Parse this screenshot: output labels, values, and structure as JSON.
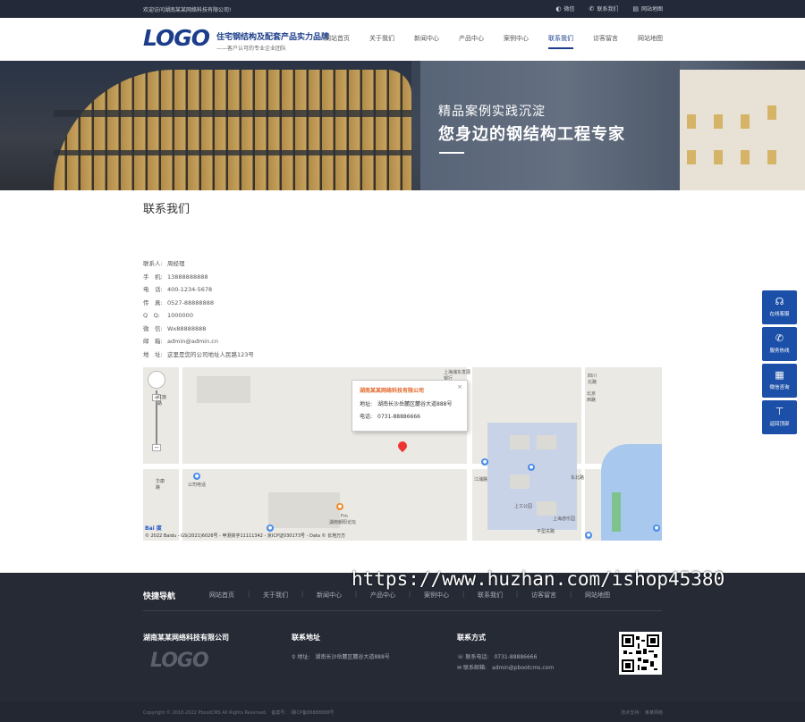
{
  "topbar": {
    "welcome": "欢迎访问湖南某某网络科技有限公司!",
    "links": [
      {
        "icon": "wechat-icon",
        "label": "微信"
      },
      {
        "icon": "phone-icon",
        "label": "联系我们"
      },
      {
        "icon": "sitemap-icon",
        "label": "网站地图"
      }
    ]
  },
  "header": {
    "logo": "LOGO",
    "slogan_main": "住宅钢结构及配套产品实力品牌",
    "slogan_sub": "——客户认可的专业企业团队",
    "nav": [
      "网站首页",
      "关于我们",
      "新闻中心",
      "产品中心",
      "案例中心",
      "联系我们",
      "访客留言",
      "网站地图"
    ],
    "active_nav": "联系我们"
  },
  "banner": {
    "line1": "精品案例实践沉淀",
    "line2": "您身边的钢结构工程专家"
  },
  "page": {
    "title": "联系我们"
  },
  "contact": [
    {
      "label": "联系人:",
      "value": "周经理"
    },
    {
      "label": "手　机:",
      "value": "13888888888"
    },
    {
      "label": "电　话:",
      "value": "400-1234-5678"
    },
    {
      "label": "传　真:",
      "value": "0527-88888888"
    },
    {
      "label": "Q　Q:",
      "value": "1000000"
    },
    {
      "label": "微　信:",
      "value": "Wx88888888"
    },
    {
      "label": "邮　箱:",
      "value": "admin@admin.cn"
    },
    {
      "label": "地　址:",
      "value": "这里是您的公司地址人民路123号"
    }
  ],
  "map": {
    "popup_title": "湖南某某网络科技有限公司",
    "popup_address": "地址:　湖南长沙岳麓区麓谷大道888号",
    "popup_phone": "电话:　0731-88886666",
    "close": "×",
    "labels": [
      "上海浦东发展银行",
      "公司电话",
      "华康路",
      "Fm",
      "湖南朝阳论坛",
      "江浦路",
      "四川北路",
      "上海游乐园",
      "红旗路",
      "东北路",
      "上工公园",
      "北京西路",
      "平型关路"
    ],
    "footer": "© 2022 Baidu - GS(2021)6026号 - 甲测资字11111342 - 京ICP证030173号 - Data © 长地万方",
    "baidu_logo": "Bai 度",
    "zoom_in": "+",
    "zoom_out": "−"
  },
  "float_bar": [
    {
      "icon": "headset-icon",
      "label": "在线客服"
    },
    {
      "icon": "phone-icon",
      "label": "服务热线"
    },
    {
      "icon": "qrcode-icon",
      "label": "微信咨询"
    },
    {
      "icon": "arrow-up-icon",
      "label": "返回顶部"
    }
  ],
  "watermark": "https://www.huzhan.com/ishop45380",
  "footer": {
    "quick_nav_title": "快捷导航",
    "quick_links": [
      "网站首页",
      "关于我们",
      "新闻中心",
      "产品中心",
      "案例中心",
      "联系我们",
      "访客留言",
      "网站地图"
    ],
    "separator": "|",
    "company": "湖南某某网络科技有限公司",
    "logo": "LOGO",
    "address_title": "联系地址",
    "address": "地址:　湖南长沙岳麓区麓谷大道888号",
    "contact_title": "联系方式",
    "phone": "联系电话:　0731-88886666",
    "email": "联系邮箱:　admin@pbootcms.com",
    "copyright": "Copyright © 2018-2022 PbootCMS All Rights Reserved.　备案号:　湘ICP备88888888号",
    "support": "技术支持:　某某网络"
  },
  "colors": {
    "primary": "#1b4fa8",
    "logo": "#1b3d8a",
    "topbar_bg": "#232938",
    "footer_bg": "#262a35",
    "popup_title": "#e3662a"
  }
}
